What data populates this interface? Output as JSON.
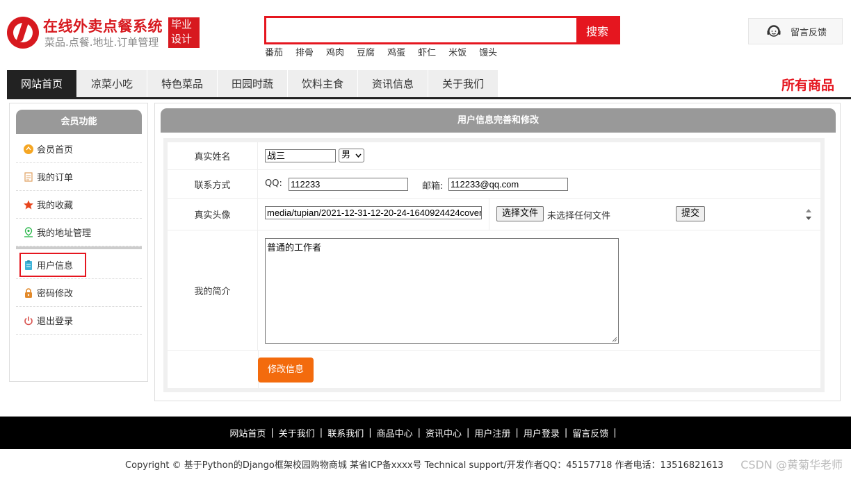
{
  "header": {
    "logo_title": "在线外卖点餐系统",
    "logo_subtitle": "菜品.点餐.地址.订单管理",
    "logo_badge_line1": "毕业",
    "logo_badge_line2": "设计",
    "search_value": "",
    "search_button": "搜索",
    "hot_words": [
      "番茄",
      "排骨",
      "鸡肉",
      "豆腐",
      "鸡蛋",
      "虾仁",
      "米饭",
      "馒头"
    ],
    "feedback": "留言反馈"
  },
  "nav": {
    "tabs": [
      "网站首页",
      "凉菜小吃",
      "特色菜品",
      "田园时蔬",
      "饮料主食",
      "资讯信息",
      "关于我们"
    ],
    "active_index": 0,
    "all_products": "所有商品"
  },
  "sidebar": {
    "title": "会员功能",
    "items": [
      {
        "label": "会员首页",
        "icon": "home-icon"
      },
      {
        "label": "我的订单",
        "icon": "order-icon"
      },
      {
        "label": "我的收藏",
        "icon": "star-icon"
      },
      {
        "label": "我的地址管理",
        "icon": "location-icon"
      },
      {
        "label": "用户信息",
        "icon": "user-info-icon"
      },
      {
        "label": "密码修改",
        "icon": "lock-icon"
      },
      {
        "label": "退出登录",
        "icon": "power-icon"
      }
    ],
    "active_item": "用户信息"
  },
  "main": {
    "title": "用户信息完善和修改",
    "form": {
      "name_label": "真实姓名",
      "name_value": "战三",
      "gender_value": "男",
      "contact_label": "联系方式",
      "qq_label": "QQ:",
      "qq_value": "112233",
      "email_label": "邮箱:",
      "email_value": "112233@qq.com",
      "avatar_label": "真实头像",
      "avatar_path": "media/tupian/2021-12-31-12-20-24-1640924424cover",
      "choose_file": "选择文件",
      "no_file": "未选择任何文件",
      "upload_button": "提交",
      "intro_label": "我的简介",
      "intro_value": "普通的工作者",
      "submit_button": "修改信息"
    }
  },
  "footer": {
    "links": [
      "网站首页",
      "关于我们",
      "联系我们",
      "商品中心",
      "资讯中心",
      "用户注册",
      "用户登录",
      "留言反馈"
    ],
    "copyright": "Copyright © 基于Python的Django框架校园购物商城 某省ICP备xxxx号    Technical support/开发作者QQ：45157718     作者电话：13516821613",
    "watermark": "CSDN @黄菊华老师"
  },
  "colors": {
    "brand_red": "#e5161f",
    "nav_active": "#222222",
    "panel_header": "#999999",
    "submit_orange": "#f36b0d"
  }
}
